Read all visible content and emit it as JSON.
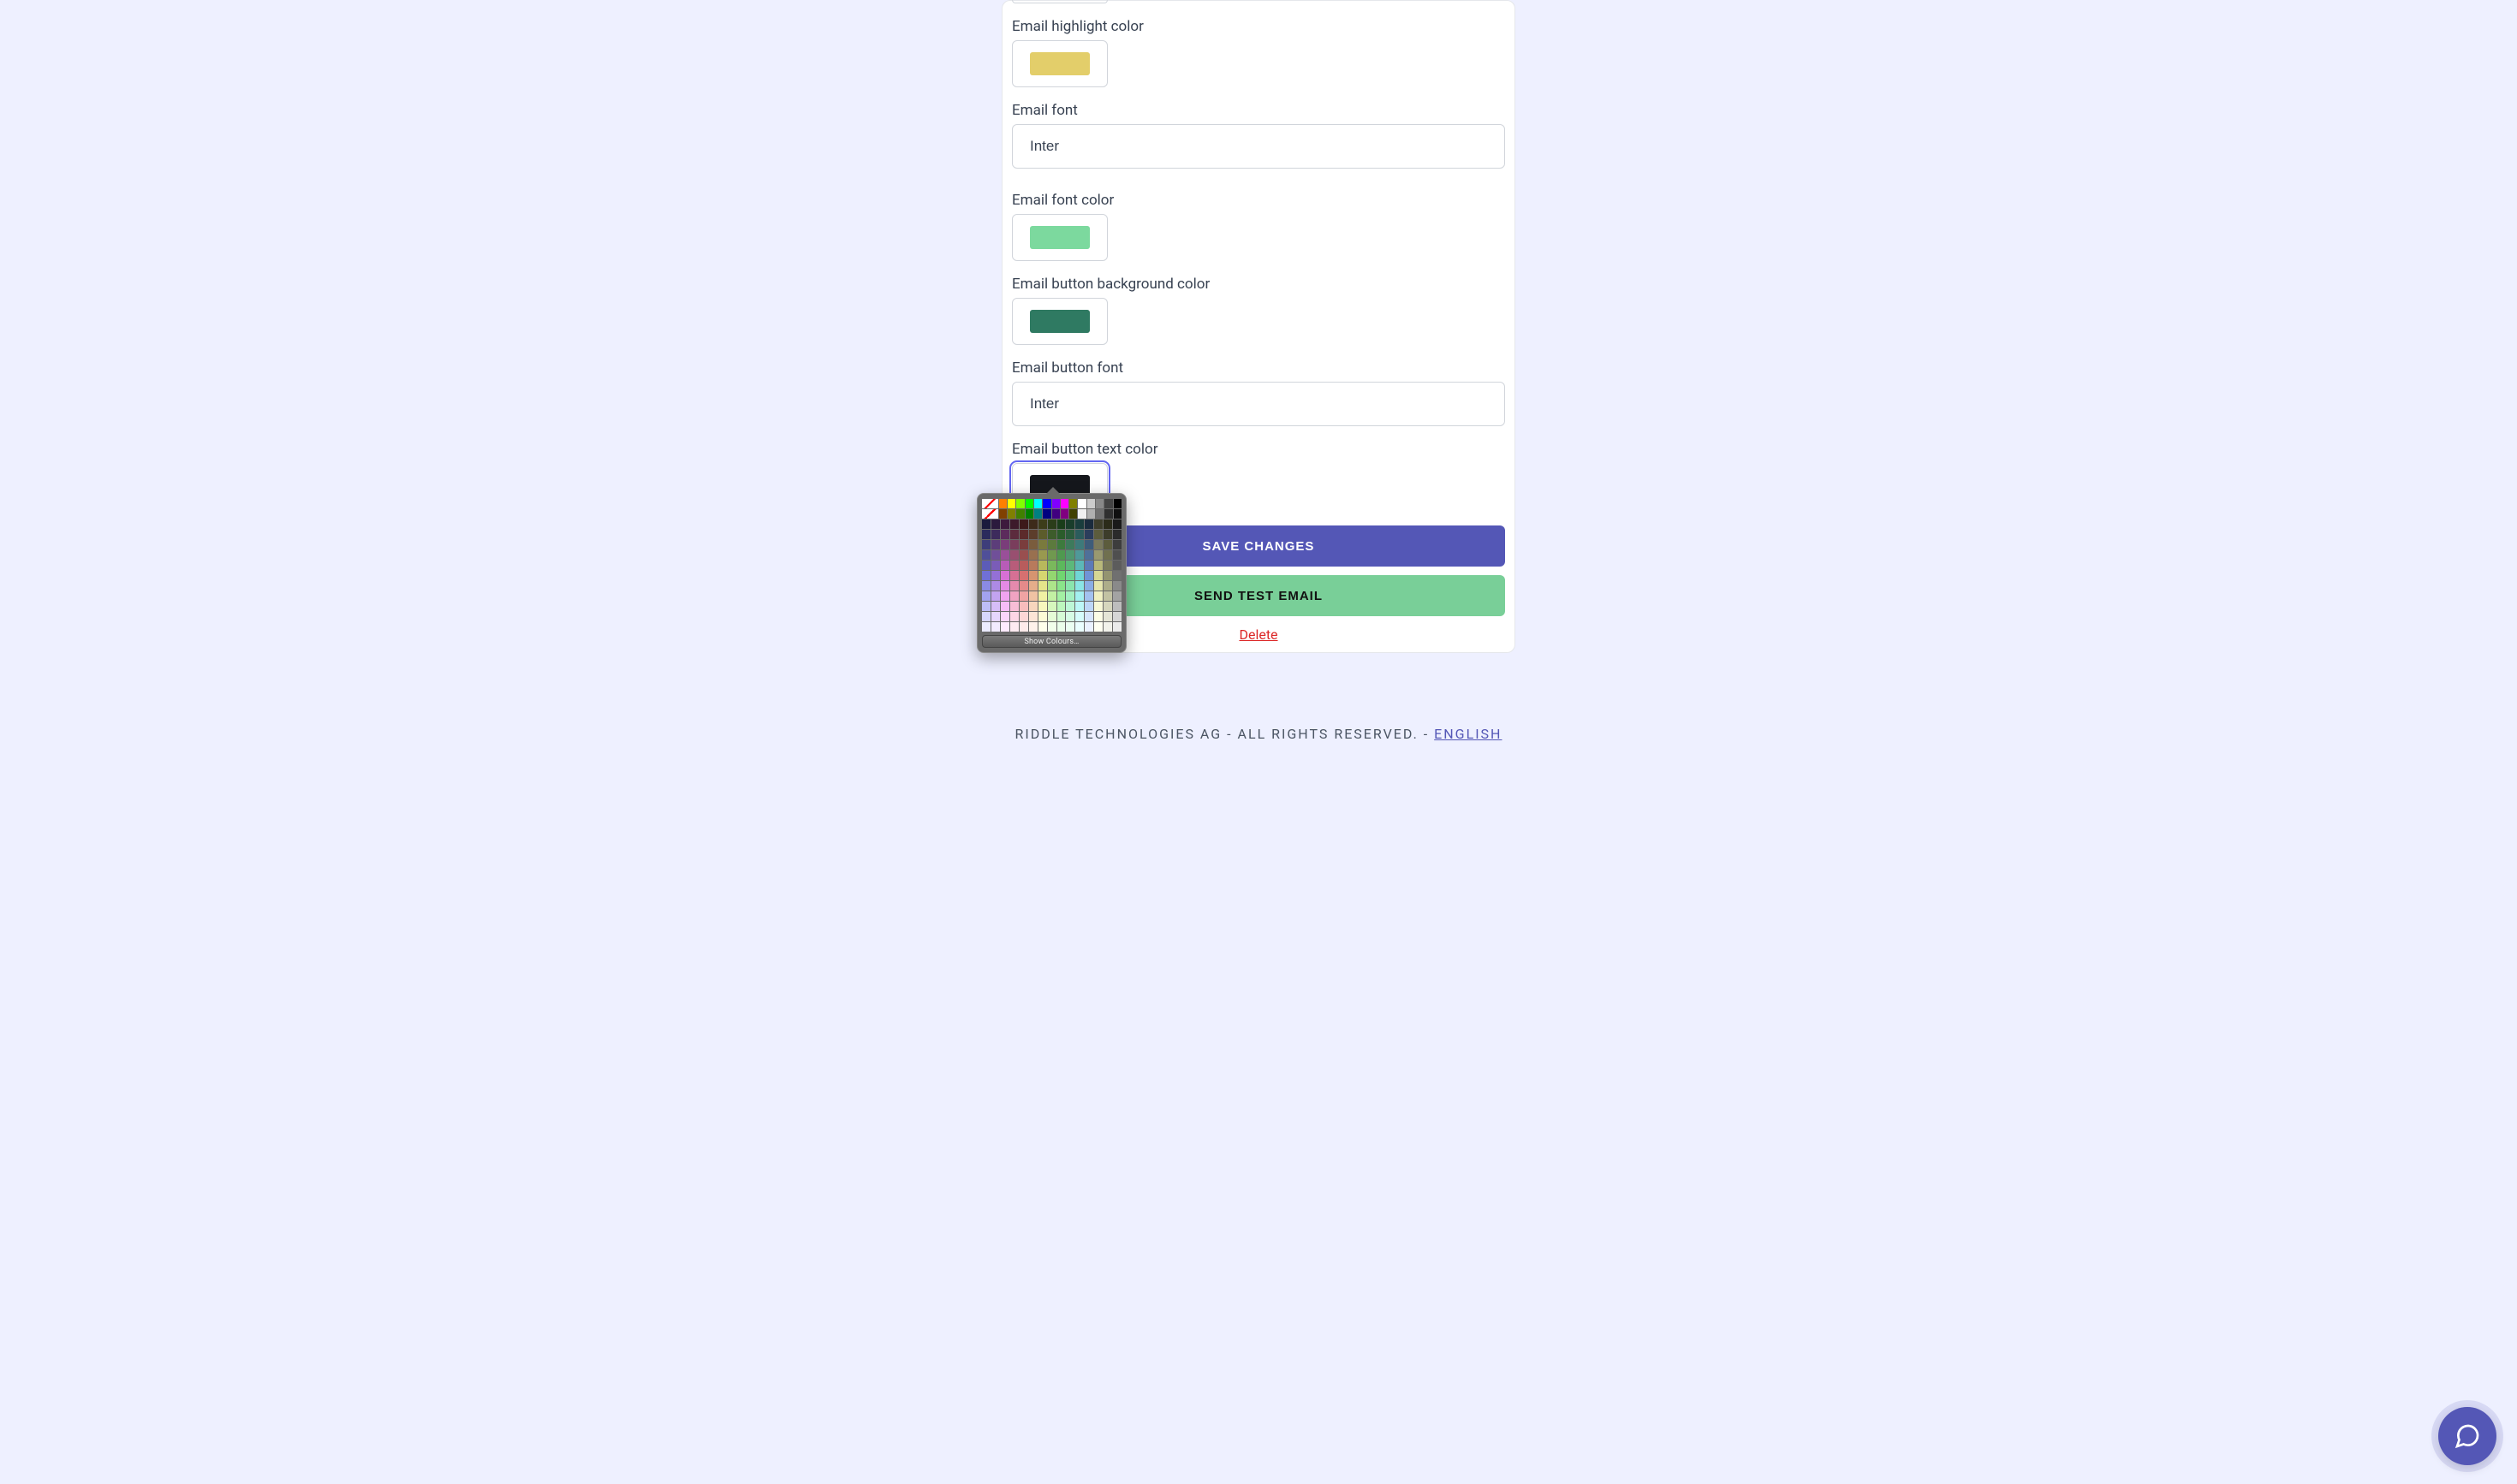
{
  "form": {
    "email_highlight_color": {
      "label": "Email highlight color",
      "value": "#e3ce6a"
    },
    "email_font": {
      "label": "Email font",
      "value": "Inter"
    },
    "email_font_color": {
      "label": "Email font color",
      "value": "#7cd99e"
    },
    "email_button_bg_color": {
      "label": "Email button background color",
      "value": "#2f7a62"
    },
    "email_button_font": {
      "label": "Email button font",
      "value": "Inter"
    },
    "email_button_text_color": {
      "label": "Email button text color",
      "value": "#15171c"
    }
  },
  "actions": {
    "save": "SAVE CHANGES",
    "send_test": "SEND TEST EMAIL",
    "delete": "Delete"
  },
  "footer": {
    "left": "RIDDLE TECHNOLOGIES AG - ALL RIGHTS RESERVED. - ",
    "lang": "ENGLISH"
  },
  "color_picker": {
    "show_colours": "Show Colours…",
    "row1": [
      "#ff0000",
      "#ff8000",
      "#ffff00",
      "#80ff00",
      "#00ff00",
      "#00ffff",
      "#0000ff",
      "#8000ff",
      "#ff00ff",
      "#808000",
      "#ffffff",
      "#cccccc",
      "#888888",
      "#444444",
      "#000000"
    ],
    "row2": [
      "#800000",
      "#804000",
      "#808000",
      "#408000",
      "#008000",
      "#008080",
      "#000080",
      "#400080",
      "#800080",
      "#404000",
      "#f0f0f0",
      "#b0b0b0",
      "#707070",
      "#303030",
      "#101010"
    ],
    "grid_rows": [
      [
        "#1a1a3d",
        "#2b1a3d",
        "#3d1a3d",
        "#3d1a2b",
        "#3d1a1a",
        "#3d2b1a",
        "#3d3d1a",
        "#2b3d1a",
        "#1a3d1a",
        "#1a3d2b",
        "#1a3d3d",
        "#1a2b3d",
        "#3d3d2b",
        "#2b2b1a",
        "#1a1a1a"
      ],
      [
        "#2b2b5c",
        "#3d2b5c",
        "#5c2b5c",
        "#5c2b3d",
        "#5c2b2b",
        "#5c3d2b",
        "#5c5c2b",
        "#3d5c2b",
        "#2b5c2b",
        "#2b5c3d",
        "#2b5c5c",
        "#2b3d5c",
        "#5c5c3d",
        "#3d3d2b",
        "#2b2b2b"
      ],
      [
        "#3d3d7a",
        "#5c3d7a",
        "#7a3d7a",
        "#7a3d5c",
        "#7a3d3d",
        "#7a5c3d",
        "#7a7a3d",
        "#5c7a3d",
        "#3d7a3d",
        "#3d7a5c",
        "#3d7a7a",
        "#3d5c7a",
        "#7a7a5c",
        "#5c5c3d",
        "#3d3d3d"
      ],
      [
        "#4f4f99",
        "#704f99",
        "#994f99",
        "#994f70",
        "#994f4f",
        "#99704f",
        "#99994f",
        "#70994f",
        "#4f994f",
        "#4f9970",
        "#4f9999",
        "#4f7099",
        "#999970",
        "#70704f",
        "#4f4f4f"
      ],
      [
        "#5c5cb8",
        "#7a5cb8",
        "#b85cb8",
        "#b85c7a",
        "#b85c5c",
        "#b87a5c",
        "#b8b85c",
        "#7ab85c",
        "#5cb85c",
        "#5cb87a",
        "#5cb8b8",
        "#5c7ab8",
        "#b8b87a",
        "#7a7a5c",
        "#5c5c5c"
      ],
      [
        "#7070d6",
        "#9470d6",
        "#d670d6",
        "#d67094",
        "#d67070",
        "#d69470",
        "#d6d670",
        "#94d670",
        "#70d670",
        "#70d694",
        "#70d6d6",
        "#7094d6",
        "#d6d694",
        "#949470",
        "#707070"
      ],
      [
        "#8a8ae5",
        "#ad8ae5",
        "#e58ae5",
        "#e58aad",
        "#e58a8a",
        "#e5ad8a",
        "#e5e58a",
        "#ade58a",
        "#8ae58a",
        "#8ae5ad",
        "#8ae5e5",
        "#8aade5",
        "#e5e5ad",
        "#adad8a",
        "#8a8a8a"
      ],
      [
        "#a3a3f0",
        "#c2a3f0",
        "#f0a3f0",
        "#f0a3c2",
        "#f0a3a3",
        "#f0c2a3",
        "#f0f0a3",
        "#c2f0a3",
        "#a3f0a3",
        "#a3f0c2",
        "#a3f0f0",
        "#a3c2f0",
        "#f0f0c2",
        "#c2c2a3",
        "#a3a3a3"
      ],
      [
        "#bdbdf7",
        "#d6bdf7",
        "#f7bdf7",
        "#f7bdd6",
        "#f7bdbd",
        "#f7d6bd",
        "#f7f7bd",
        "#d6f7bd",
        "#bdf7bd",
        "#bdf7d6",
        "#bdf7f7",
        "#bdd6f7",
        "#f7f7d6",
        "#d6d6bd",
        "#bdbdbd"
      ],
      [
        "#d6d6fc",
        "#e5d6fc",
        "#fcd6fc",
        "#fcd6e5",
        "#fcd6d6",
        "#fce5d6",
        "#fcfcd6",
        "#e5fcd6",
        "#d6fcd6",
        "#d6fce5",
        "#d6fcfc",
        "#d6e5fc",
        "#fcfce5",
        "#e5e5d6",
        "#d6d6d6"
      ],
      [
        "#ebebff",
        "#f2ebff",
        "#ffebff",
        "#ffebf2",
        "#ffebeb",
        "#fff2eb",
        "#ffffeb",
        "#f2ffeb",
        "#ebffeb",
        "#ebfff2",
        "#ebffff",
        "#ebf2ff",
        "#fffff2",
        "#f2f2eb",
        "#ebebeb"
      ]
    ]
  }
}
